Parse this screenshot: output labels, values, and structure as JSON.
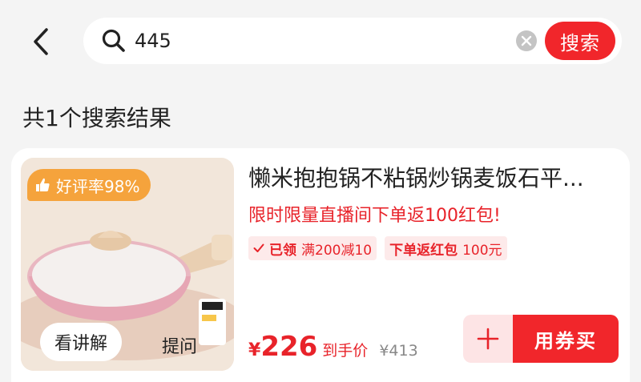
{
  "search": {
    "query": "445",
    "button_label": "搜索"
  },
  "results": {
    "count_text": "共1个搜索结果"
  },
  "product": {
    "title": "懒米抱抱锅不粘锅炒锅麦饭石平...",
    "rating_badge": "好评率98%",
    "promo_text": "限时限量直播间下单返100红包!",
    "coupons": [
      {
        "status": "已领",
        "text": "满200减10"
      },
      {
        "status": "下单返红包",
        "text": "100元"
      }
    ],
    "price_symbol": "¥",
    "price": "226",
    "price_note": "到手价",
    "original_price": "¥413",
    "image_actions": {
      "watch": "看讲解",
      "ask": "提问"
    },
    "buy_label": "用券买"
  },
  "colors": {
    "accent": "#f1262b",
    "promo": "#e8232a",
    "badge": "#f5a33c"
  }
}
